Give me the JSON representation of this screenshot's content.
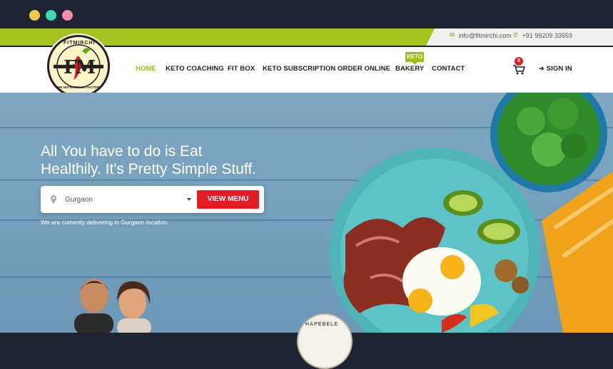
{
  "window": {
    "dots": [
      {
        "name": "window-dot-yellow",
        "color": "#f2c94c"
      },
      {
        "name": "window-dot-green",
        "color": "#3ddbb0"
      },
      {
        "name": "window-dot-pink",
        "color": "#f58fa8"
      }
    ]
  },
  "topbar": {
    "email": "info@fitmirchi.com",
    "phone": "+91 99209 33559",
    "email_icon": "envelope-icon",
    "phone_icon": "phone-icon"
  },
  "logo": {
    "top_text": "FITMIRCHI",
    "monogram": "FM",
    "bottom_text": "THE NUTRITIONAL FACTORY"
  },
  "nav": {
    "items": [
      "HOME",
      "KETO COACHING",
      "FIT BOX",
      "KETO SUBSCRIPTION",
      "ORDER ONLINE",
      "BAKERY",
      "CONTACT"
    ],
    "active": "HOME",
    "badge": "KETO",
    "cart_count": "0",
    "signin": "SIGN IN"
  },
  "hero": {
    "title_line1": "All You have to do is Eat",
    "title_line2": "Healthily. It's Pretty Simple Stuff.",
    "location_value": "Gurgaon",
    "button": "VIEW MENU",
    "delivery_note": "We are currently delivering in Gurgaon location.",
    "stamp_text": "HAPEBELE"
  },
  "colors": {
    "accent_green": "#a4c41d",
    "brand_red": "#e01e24",
    "dark": "#1f2433",
    "hero_blue": "#7fa7c2"
  }
}
